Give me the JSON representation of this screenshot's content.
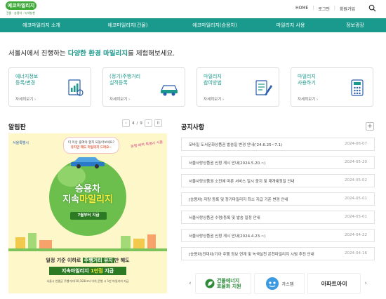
{
  "logo": {
    "title": "에코마일리지",
    "sub": "건물 · 승용차 · 녹색실천"
  },
  "top_links": {
    "home": "HOME",
    "login": "로그인",
    "signup": "회원가입"
  },
  "nav": [
    "에코마일리지 소개",
    "에코마일리지(건물)",
    "에코마일리지(승용차)",
    "마일리지 사용",
    "정보광장"
  ],
  "headline": {
    "prefix": "서울시에서 진행하는 ",
    "highlight": "다양한 환경 마일리지",
    "suffix": "를 체험해보세요."
  },
  "cards": [
    {
      "line1": "에너지정보",
      "line2": "등록/변경",
      "more": "자세히보기 ›"
    },
    {
      "line1": "(정기)주행거리",
      "line2": "실적등록",
      "more": "자세히보기 ›"
    },
    {
      "line1": "마일리지",
      "line2": "참여방법",
      "more": "자세히보기 ›"
    },
    {
      "line1": "마일리지",
      "line2": "사용하기",
      "more": "자세히보기 ›"
    }
  ],
  "board": {
    "title": "알림판",
    "current": "4",
    "total": "9",
    "prev": "‹",
    "next": "›",
    "pause": "II",
    "banner": {
      "brand": "서울특별시",
      "slogan": "동행·매력 특별시 서울",
      "bubble1": "더 이상 줄여야 할지 되돌아보세요?",
      "bubble2": "유지만 해도 마일리지 드려요~",
      "title1": "승용차",
      "title2a": "지속",
      "title2b": "마일리지",
      "tag": "7월부터 지급",
      "tagline_a": "일정 기준 이하로 ",
      "tagline_box": "주행거리 유지",
      "tagline_b": "만 해도",
      "tagline2_a": "지속마일리지 ",
      "tagline2_b": "1만점",
      "tagline2_c": " 지급",
      "fine": "서울시 연평균 주행거리(10,183km) 이하 운행 시 1만 마일리지 지급"
    }
  },
  "notices": {
    "title": "공지사항",
    "plus": "+",
    "items": [
      {
        "text": "모바일 도서문화상품권 발송일 변경 안내('24.6.25~7.1)",
        "date": "2024-06-07"
      },
      {
        "text": "서울사랑상품권 신청 게시 안내(2024.5.20.~)",
        "date": "2024-05-20"
      },
      {
        "text": "서울사랑상품권 소진에 따른 서비스 일시 중지 및 재개예정일 안내",
        "date": "2024-05-02"
      },
      {
        "text": "[승용차] 자량 등록 및 정기마일리지 최소 지급 기준 변경 안내",
        "date": "2024-05-01"
      },
      {
        "text": "서울사랑상품권 수령/등록 및 발송 일정 안내",
        "date": "2024-05-01"
      },
      {
        "text": "서울사랑상품권 신청 게시 안내(2024.4.23.~)",
        "date": "2024-04-22"
      },
      {
        "text": "[승용차]전대차/기아 주행 정보 연계 및 녹색실천 온천마일리지 시범 추진 안내",
        "date": "2024-04-16"
      }
    ]
  },
  "quick_links": {
    "prev": "‹",
    "next": "›",
    "building_a": "건물에너지",
    "building_b": "효율화 지원",
    "gas": "가스앱",
    "apt": "아파트아이"
  },
  "colors": {
    "brand": "#1a9a8c",
    "green": "#3aaa35",
    "banner_bg": "#fdf7c9"
  }
}
